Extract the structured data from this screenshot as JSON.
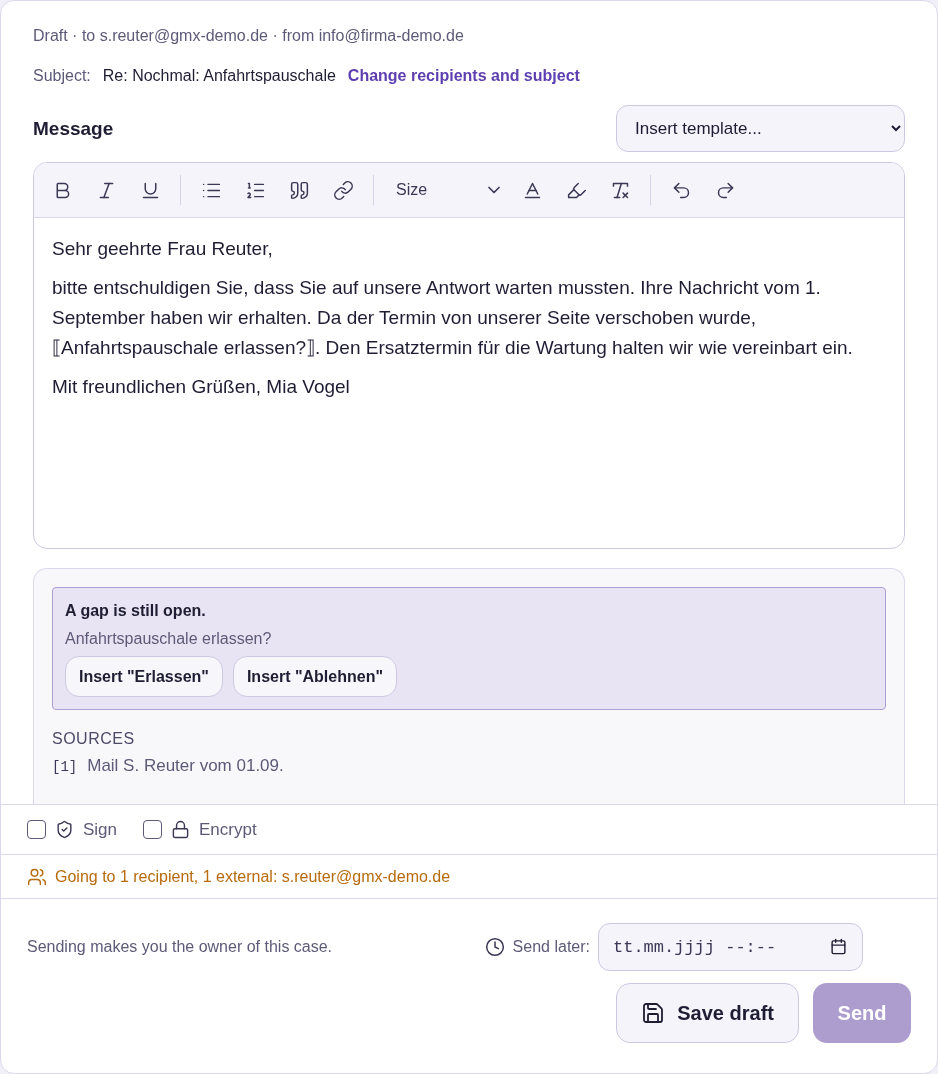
{
  "header": {
    "meta": "Draft · to s.reuter@gmx-demo.de · from info@firma-demo.de",
    "subject_label": "Subject:",
    "subject": "Re: Nochmal: Anfahrtspauschale",
    "change_link": "Change recipients and subject"
  },
  "message": {
    "label": "Message",
    "template_select": "Insert template...",
    "toolbar": [
      {
        "kind": "bold"
      },
      {
        "kind": "italic"
      },
      {
        "kind": "underline"
      },
      {
        "kind": "divider"
      },
      {
        "kind": "bullets"
      },
      {
        "kind": "numbers"
      },
      {
        "kind": "quote"
      },
      {
        "kind": "link"
      },
      {
        "kind": "divider"
      },
      {
        "kind": "size",
        "label": "Size"
      },
      {
        "kind": "color"
      },
      {
        "kind": "highlight"
      },
      {
        "kind": "clear"
      },
      {
        "kind": "divider"
      },
      {
        "kind": "undo"
      },
      {
        "kind": "redo"
      }
    ],
    "paragraphs": [
      "Sehr geehrte Frau Reuter,",
      "bitte entschuldigen Sie, dass Sie auf unsere Antwort warten mussten. Ihre Nachricht vom 1. September haben wir erhalten. Da der Termin von unserer Seite verschoben wurde, ⟦Anfahrtspauschale erlassen?⟧. Den Ersatztermin für die Wartung halten wir wie vereinbart ein.",
      "Mit freundlichen Grüßen, Mia Vogel"
    ]
  },
  "gap": {
    "title": "A gap is still open.",
    "question": "Anfahrtspauschale erlassen?",
    "buttons": [
      "Insert \"Erlassen\"",
      "Insert \"Ablehnen\""
    ]
  },
  "sources": {
    "title": "SOURCES",
    "items": [
      {
        "index": "[1]",
        "text": "Mail S. Reuter vom 01.09."
      }
    ]
  },
  "options": [
    {
      "kind": "sign",
      "label": "Sign",
      "checked": false
    },
    {
      "kind": "encrypt",
      "label": "Encrypt",
      "checked": false
    }
  ],
  "recipients_note": "Going to 1 recipient, 1 external: s.reuter@gmx-demo.de",
  "footer": {
    "note": "Sending makes you the owner of this case.",
    "send_later_label": "Send later:",
    "send_later_placeholder": "tt.mm.jjjj --:--",
    "save_button": "Save draft",
    "send_button": {
      "label": "Send",
      "disabled": true
    }
  }
}
